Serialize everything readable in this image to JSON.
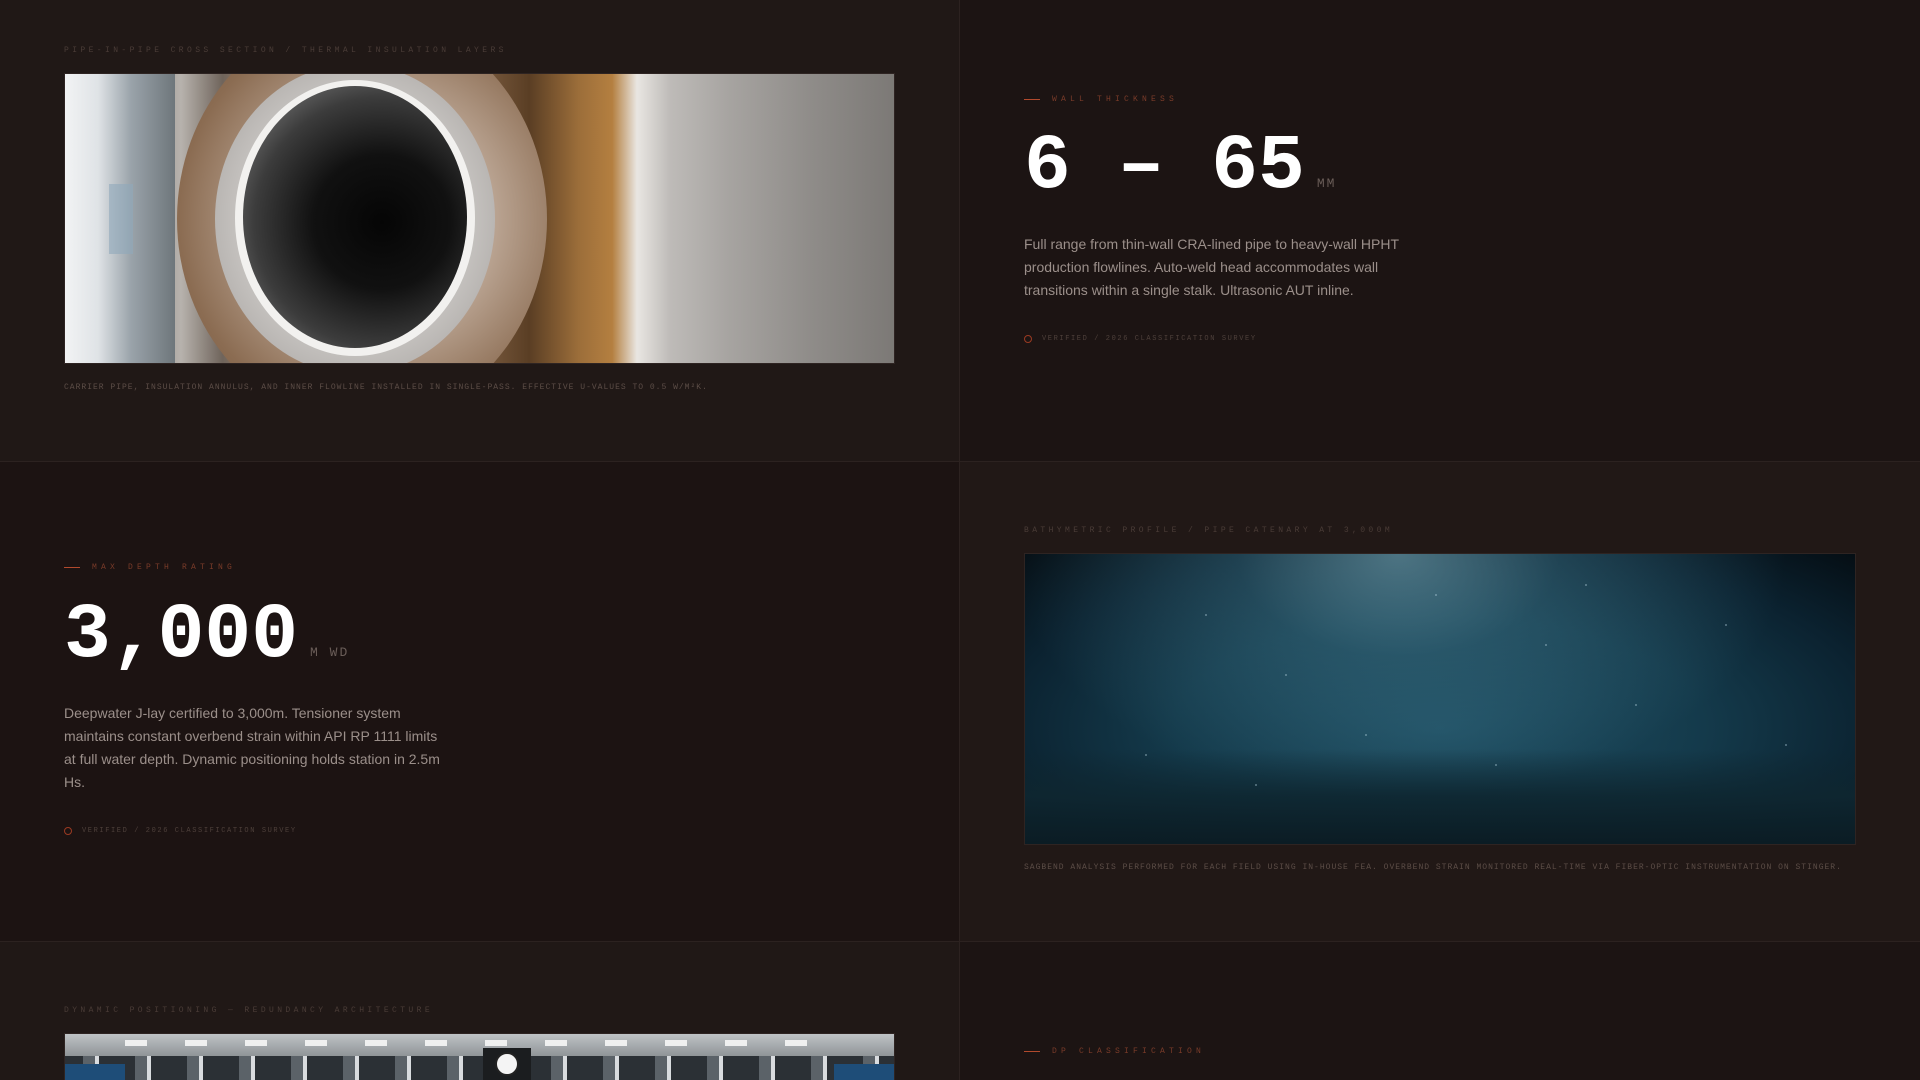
{
  "sections": {
    "pipe_section": {
      "eyebrow": "PIPE-IN-PIPE CROSS SECTION / THERMAL INSULATION LAYERS",
      "caption": "CARRIER PIPE, INSULATION ANNULUS, AND INNER FLOWLINE INSTALLED IN SINGLE-PASS. EFFECTIVE U-VALUES TO 0.5 W/M²K."
    },
    "wall_thickness": {
      "label": "WALL THICKNESS",
      "value": "6 – 65",
      "unit": "MM",
      "description": "Full range from thin-wall CRA-lined pipe to heavy-wall HPHT production flowlines. Auto-weld head accommodates wall transitions within a single stalk. Ultrasonic AUT inline.",
      "verified": "VERIFIED / 2026 CLASSIFICATION SURVEY"
    },
    "depth_rating": {
      "label": "MAX DEPTH RATING",
      "value": "3,000",
      "unit": "M WD",
      "description": "Deepwater J-lay certified to 3,000m. Tensioner system maintains constant overbend strain within API RP 1111 limits at full water depth. Dynamic positioning holds station in 2.5m Hs.",
      "verified": "VERIFIED / 2026 CLASSIFICATION SURVEY"
    },
    "bathymetric": {
      "eyebrow": "BATHYMETRIC PROFILE / PIPE CATENARY AT 3,000M",
      "caption": "SAGBEND ANALYSIS PERFORMED FOR EACH FIELD USING IN-HOUSE FEA. OVERBEND STRAIN MONITORED REAL-TIME VIA FIBER-OPTIC INSTRUMENTATION ON STINGER."
    },
    "dynamic_positioning": {
      "eyebrow": "DYNAMIC POSITIONING — REDUNDANCY ARCHITECTURE"
    },
    "dp_classification": {
      "label": "DP CLASSIFICATION"
    }
  },
  "colors": {
    "accent": "#b24a2d",
    "background": "#1c1413",
    "text_primary": "#ffffff",
    "text_muted": "#9b8f8a"
  },
  "icons": {
    "verified": "verified-ring-icon",
    "label_dash": "accent-dash-icon"
  }
}
